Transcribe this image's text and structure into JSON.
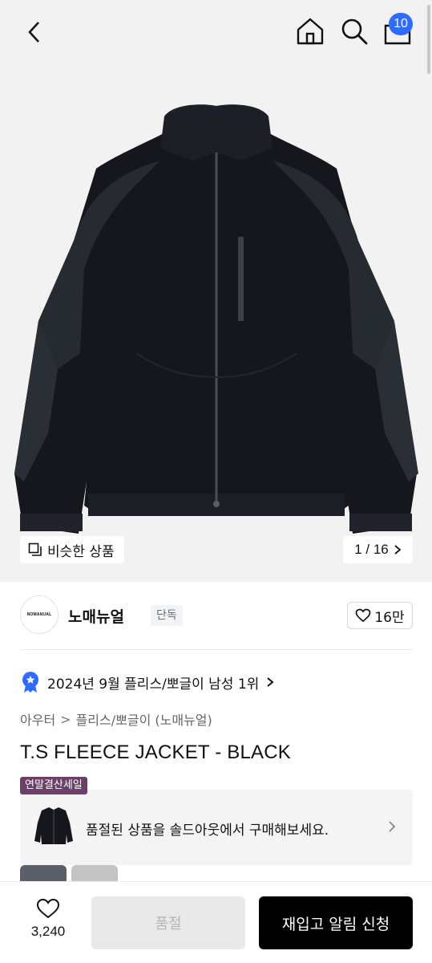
{
  "header": {
    "icons": [
      "back-icon",
      "home-icon",
      "search-icon",
      "cart-icon"
    ],
    "cart_count": "10",
    "accent_color": "#2f6bff"
  },
  "gallery": {
    "similar_label": "비슷한 상품",
    "page_indicator": "1 / 16",
    "image_alt": "T.S FLEECE JACKET - BLACK"
  },
  "brand": {
    "logo_text": "NOMANUAL",
    "name": "노매뉴얼",
    "exclusive_tag": "단독",
    "likes": "16만"
  },
  "ranking": {
    "text": "2024년 9월 플리스/뽀글이 남성 1위"
  },
  "breadcrumb": {
    "items": [
      "아우터",
      "플리스/뽀글이 (노매뉴얼)"
    ],
    "separator": ">"
  },
  "product": {
    "title": "T.S FLEECE JACKET - BLACK",
    "sale_tag": "연말결산세일"
  },
  "soldout_card": {
    "text": "품절된 상품을 솔드아웃에서 구매해보세요."
  },
  "bottom_bar": {
    "wish_count": "3,240",
    "soldout_label": "품절",
    "restock_label": "재입고 알림 신청"
  }
}
